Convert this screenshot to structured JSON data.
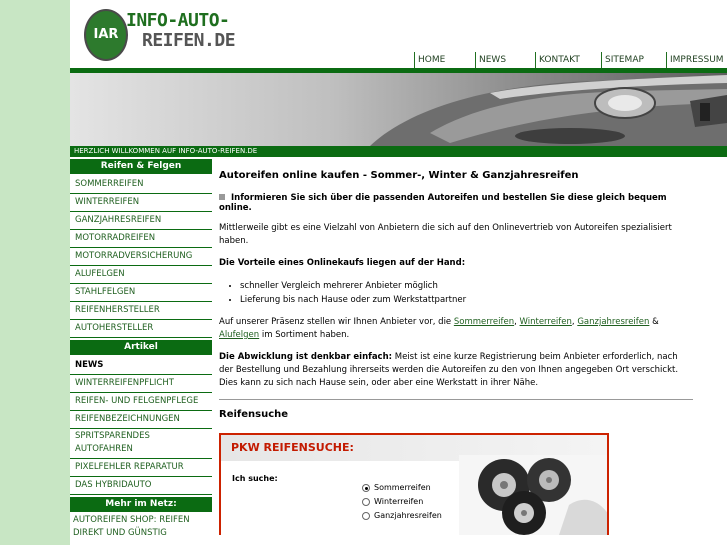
{
  "logo": {
    "badge": "IAR",
    "line1": "INFO-AUTO-",
    "line2": "REIFEN.DE"
  },
  "topnav": [
    "HOME",
    "NEWS",
    "KONTAKT",
    "SITEMAP",
    "IMPRESSUM"
  ],
  "welcome": "HERZLICH WILLKOMMEN AUF INFO-AUTO-REIFEN.DE",
  "sidebar": {
    "reifen_head": "Reifen & Felgen",
    "reifen_items": [
      "SOMMERREIFEN",
      "WINTERREIFEN",
      "GANZJAHRESREIFEN",
      "MOTORRADREIFEN",
      "MOTORRADVERSICHERUNG",
      "ALUFELGEN",
      "STAHLFELGEN",
      "REIFENHERSTELLER",
      "AUTOHERSTELLER"
    ],
    "artikel_head": "Artikel",
    "artikel_items": [
      "NEWS",
      "WINTERREIFENPFLICHT",
      "REIFEN- UND FELGENPFLEGE",
      "REIFENBEZEICHNUNGEN",
      "SPRITSPARENDES AUTOFAHREN",
      "PIXELFEHLER REPARATUR",
      "DAS HYBRIDAUTO"
    ],
    "netz_head": "Mehr im Netz:",
    "netz_link": "AUTOREIFEN SHOP: REIFEN DIREKT UND GÜNSTIG"
  },
  "main": {
    "title": "Autoreifen online kaufen - Sommer-, Winter & Ganzjahresreifen",
    "intro": "Informieren Sie sich über die passenden Autoreifen und bestellen Sie diese gleich bequem online.",
    "p1": "Mittlerweile gibt es eine Vielzahl von Anbietern die sich auf den Onlinevertrieb von Autoreifen spezialisiert haben.",
    "adv_head": "Die Vorteile eines Onlinekaufs liegen auf der Hand:",
    "adv_items": [
      "schneller Vergleich mehrerer Anbieter möglich",
      "Lieferung bis nach Hause oder zum Werkstattpartner"
    ],
    "p2_pre": "Auf unserer Präsenz stellen wir Ihnen Anbieter vor, die ",
    "p2_links": [
      "Sommerreifen",
      "Winterreifen",
      "Ganzjahresreifen",
      "Alufelgen"
    ],
    "p2_sep1": ", ",
    "p2_sep2": ", ",
    "p2_sep3": " & ",
    "p2_post": " im Sortiment haben.",
    "p3_bold": "Die Abwicklung ist denkbar einfach:",
    "p3_rest": " Meist ist eine kurze Registrierung beim Anbieter erforderlich, nach der Bestellung und Bezahlung ihrerseits werden die Autoreifen zu den von Ihnen angegeben Ort verschickt. Dies kann zu sich nach Hause sein, oder aber eine Werkstatt in ihrer Nähe.",
    "search_title": "Reifensuche"
  },
  "tyre_search": {
    "header": "PKW REIFENSUCHE:",
    "label": "Ich suche:",
    "options": [
      "Sommerreifen",
      "Winterreifen",
      "Ganzjahresreifen"
    ],
    "selected": "Sommerreifen"
  },
  "colors": {
    "green": "#0b6b12",
    "page_bg": "#c8e6c4",
    "search_red": "#cc2200"
  }
}
